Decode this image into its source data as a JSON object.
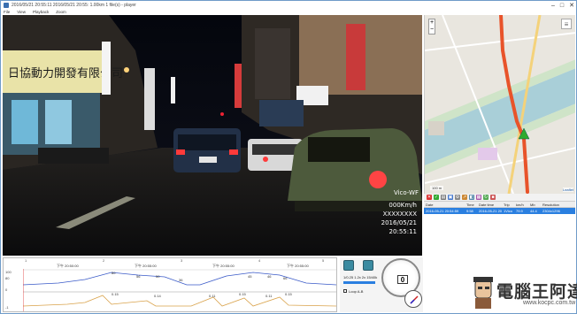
{
  "window": {
    "title": "2016/05/21 20:55:11   2016/05/21 20:55:  1.00km   1 file(s)   - player"
  },
  "menu": [
    "File",
    "View",
    "Playback",
    "Zoom"
  ],
  "video": {
    "overlay_brand": "Vico-WF",
    "overlay_speed": "000Km/h",
    "overlay_plate": "XXXXXXXX",
    "overlay_date": "2016/05/21",
    "overlay_time": "20:55:11",
    "shop_sign": "日協動力開發有限公司"
  },
  "map": {
    "zoom_in": "+",
    "zoom_out": "−",
    "scale_text": "100 m",
    "attribution": "Leaflet",
    "route_color": "#e8532a",
    "marker_color": "#2faa2f"
  },
  "table": {
    "headers": [
      "Date",
      "Time",
      "Date time",
      "Trip",
      "km/h",
      "Mb",
      "Resolution"
    ],
    "rows": [
      [
        "2016-05-21 20:54:59",
        "9:58",
        "2016-05-21 20:55",
        "1Vico",
        "79.9",
        "44.4",
        "2304x1296"
      ]
    ]
  },
  "timeline": {
    "tick_labels": [
      "1",
      "2",
      "3",
      "4",
      "5"
    ],
    "time_labels": [
      "下午 20:50:00",
      "下午 20:55:00",
      "下午 20:55:00",
      "下午 20:55:00"
    ],
    "speed_points": [
      "80",
      "56",
      "50",
      "36",
      "45",
      "46",
      "66"
    ],
    "accel_points": [
      "0.15",
      "0.14",
      "0.11",
      "0.15",
      "0.11",
      "0.15"
    ],
    "y_labels": [
      "100",
      "80",
      "0",
      "-1"
    ]
  },
  "controls": {
    "speed_readout": "1/0.25 1.2x 2x 15/40k",
    "loop_label": "Loop A-B",
    "gauge_value": "0"
  },
  "watermark": {
    "name": "電腦王阿達",
    "url": "www.kocpc.com.tw"
  }
}
